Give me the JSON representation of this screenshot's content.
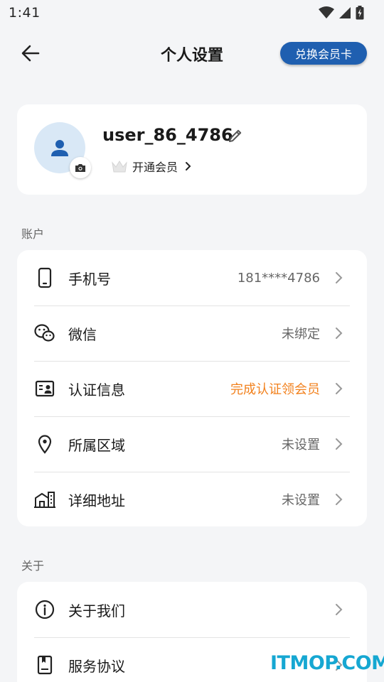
{
  "status_bar": {
    "time": "1:41"
  },
  "header": {
    "title": "个人设置",
    "redeem_label": "兑换会员卡"
  },
  "profile": {
    "username": "user_86_4786",
    "vip_label": "开通会员"
  },
  "account": {
    "section_label": "账户",
    "items": [
      {
        "label": "手机号",
        "value": "181****4786",
        "icon": "phone-icon"
      },
      {
        "label": "微信",
        "value": "未绑定",
        "icon": "wechat-icon"
      },
      {
        "label": "认证信息",
        "value": "完成认证领会员",
        "icon": "id-card-icon"
      },
      {
        "label": "所属区域",
        "value": "未设置",
        "icon": "location-pin-icon"
      },
      {
        "label": "详细地址",
        "value": "未设置",
        "icon": "building-icon"
      }
    ]
  },
  "about": {
    "section_label": "关于",
    "items": [
      {
        "label": "关于我们",
        "icon": "info-icon"
      },
      {
        "label": "服务协议",
        "icon": "document-icon"
      }
    ]
  },
  "watermark": "ITMOP.COM",
  "colors": {
    "accent": "#1f5fb0",
    "highlight": "#f2811d",
    "background": "#f4f5f7"
  }
}
